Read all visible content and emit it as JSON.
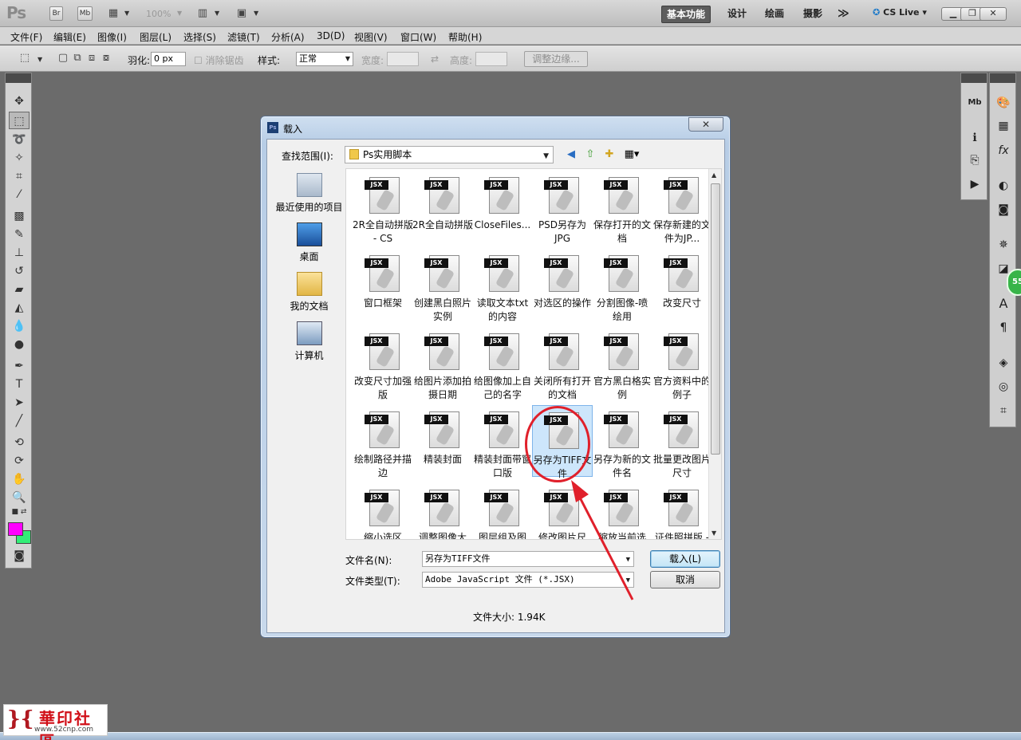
{
  "app": {
    "logo": "Ps",
    "zoom": "100%",
    "bridge_btn": "Br",
    "minibridge_btn": "Mb",
    "workspaces": [
      "基本功能",
      "设计",
      "绘画",
      "摄影"
    ],
    "more": "≫",
    "cs_live": "CS Live"
  },
  "menu": [
    "文件(F)",
    "编辑(E)",
    "图像(I)",
    "图层(L)",
    "选择(S)",
    "滤镜(T)",
    "分析(A)",
    "3D(D)",
    "视图(V)",
    "窗口(W)",
    "帮助(H)"
  ],
  "options": {
    "feather_label": "羽化:",
    "feather_value": "0 px",
    "antialias_label": "消除锯齿",
    "style_label": "样式:",
    "style_value": "正常",
    "width_label": "宽度:",
    "height_label": "高度:",
    "refine_edge": "调整边缘..."
  },
  "dialog": {
    "title": "载入",
    "ps_icon": "Ps",
    "close": "✕",
    "look_in_label": "查找范围(I):",
    "look_in_value": "Ps实用脚本",
    "places": [
      "最近使用的项目",
      "桌面",
      "我的文档",
      "计算机"
    ],
    "file_tag": "JSX",
    "files": [
      "2R全自动拼版 - CS",
      "2R全自动拼版",
      "CloseFiles...",
      "PSD另存为JPG",
      "保存打开的文档",
      "保存新建的文件为JP...",
      "窗口框架",
      "创建黑白照片实例",
      "读取文本txt的内容",
      "对选区的操作",
      "分割图像-喷绘用",
      "改变尺寸",
      "改变尺寸加强版",
      "给图片添加拍摄日期",
      "给图像加上自己的名字",
      "关闭所有打开的文档",
      "官方黑白格实例",
      "官方资料中的例子",
      "绘制路径并描边",
      "精装封面",
      "精装封面带窗口版",
      "另存为TIFF文件",
      "另存为新的文件名",
      "批量更改图片尺寸",
      "缩小选区",
      "调整图像大",
      "图层组及图",
      "修改图片尺",
      "缩放当前选",
      "证件照拼版 -"
    ],
    "selected_file": "另存为TIFF文件",
    "filename_label": "文件名(N):",
    "filename_value": "另存为TIFF文件",
    "filetype_label": "文件类型(T):",
    "filetype_value": "Adobe JavaScript 文件 (*.JSX)",
    "load_button": "载入(L)",
    "cancel_button": "取消",
    "file_size": "文件大小: 1.94K"
  },
  "badge": "55",
  "watermark": {
    "text": "華印社區",
    "url": "www.52cnp.com"
  },
  "colors": {
    "foreground": "#ff00ff",
    "background": "#33ee77",
    "annotation": "#e0202b"
  }
}
